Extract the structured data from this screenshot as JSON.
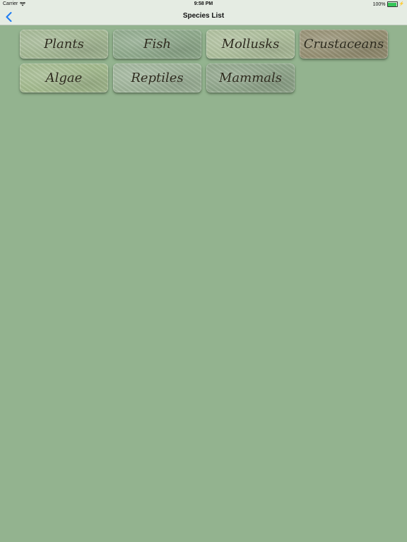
{
  "status_bar": {
    "carrier": "Carrier",
    "time": "9:58 PM",
    "battery": "100%",
    "battery_color": "#35c759"
  },
  "nav": {
    "title": "Species List",
    "back_icon": "chevron-left-icon",
    "accent_color": "#1e7cf2"
  },
  "categories": [
    {
      "label": "Plants"
    },
    {
      "label": "Fish"
    },
    {
      "label": "Mollusks"
    },
    {
      "label": "Crustaceans"
    },
    {
      "label": "Algae"
    },
    {
      "label": "Reptiles"
    },
    {
      "label": "Mammals"
    }
  ],
  "background_color": "#93b38f"
}
